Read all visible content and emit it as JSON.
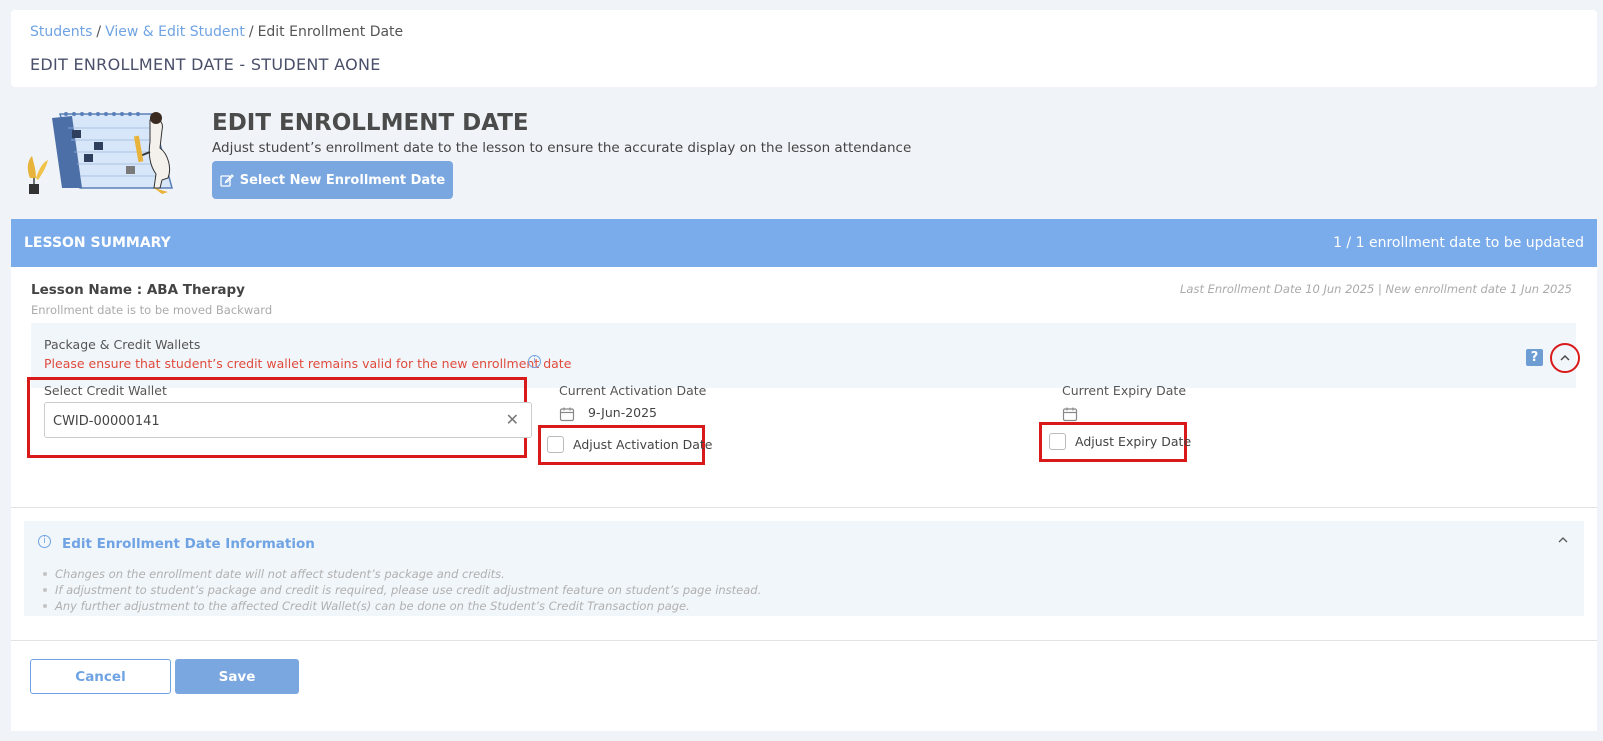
{
  "breadcrumb": {
    "items": [
      "Students",
      "View & Edit Student",
      "Edit Enrollment Date"
    ],
    "separator": "/"
  },
  "page_title": "EDIT ENROLLMENT DATE - STUDENT AONE",
  "hero": {
    "title": "EDIT ENROLLMENT DATE",
    "description": "Adjust student’s enrollment date to the lesson to ensure the accurate display on the lesson attendance",
    "select_button_label": "Select New Enrollment Date",
    "select_button_icon": "edit-icon"
  },
  "summary": {
    "title": "LESSON SUMMARY",
    "count_text": "1 / 1 enrollment date to be updated"
  },
  "lesson": {
    "name": "Lesson Name : ABA Therapy",
    "direction_note": "Enrollment date is to be moved Backward",
    "dates_note": "Last Enrollment Date 10 Jun 2025 | New enrollment date 1 Jun 2025"
  },
  "package_panel": {
    "title": "Package & Credit Wallets",
    "warning": "Please ensure that student’s credit wallet remains valid for the new enrollment date",
    "help_label": "?",
    "warning_color": "#e04a3c"
  },
  "wallet": {
    "label": "Select Credit Wallet",
    "value": "CWID-00000141",
    "clear_label": "✕"
  },
  "activation": {
    "label": "Current Activation Date",
    "value": "9-Jun-2025",
    "checkbox_label": "Adjust Activation Date"
  },
  "expiry": {
    "label": "Current Expiry Date",
    "value": "",
    "checkbox_label": "Adjust Expiry Date"
  },
  "info_panel": {
    "title": "Edit Enrollment Date Information",
    "items": [
      "Changes on the enrollment date will not affect student’s package and credits.",
      "If adjustment to student’s package and credit is required, please use credit adjustment feature on student’s page instead.",
      "Any further adjustment to the affected Credit Wallet(s) can be done on the Student’s Credit Transaction page."
    ]
  },
  "actions": {
    "cancel_label": "Cancel",
    "save_label": "Save"
  },
  "colors": {
    "accent": "#7aabea",
    "link": "#6fa3e3",
    "highlight": "#d91a1a"
  }
}
